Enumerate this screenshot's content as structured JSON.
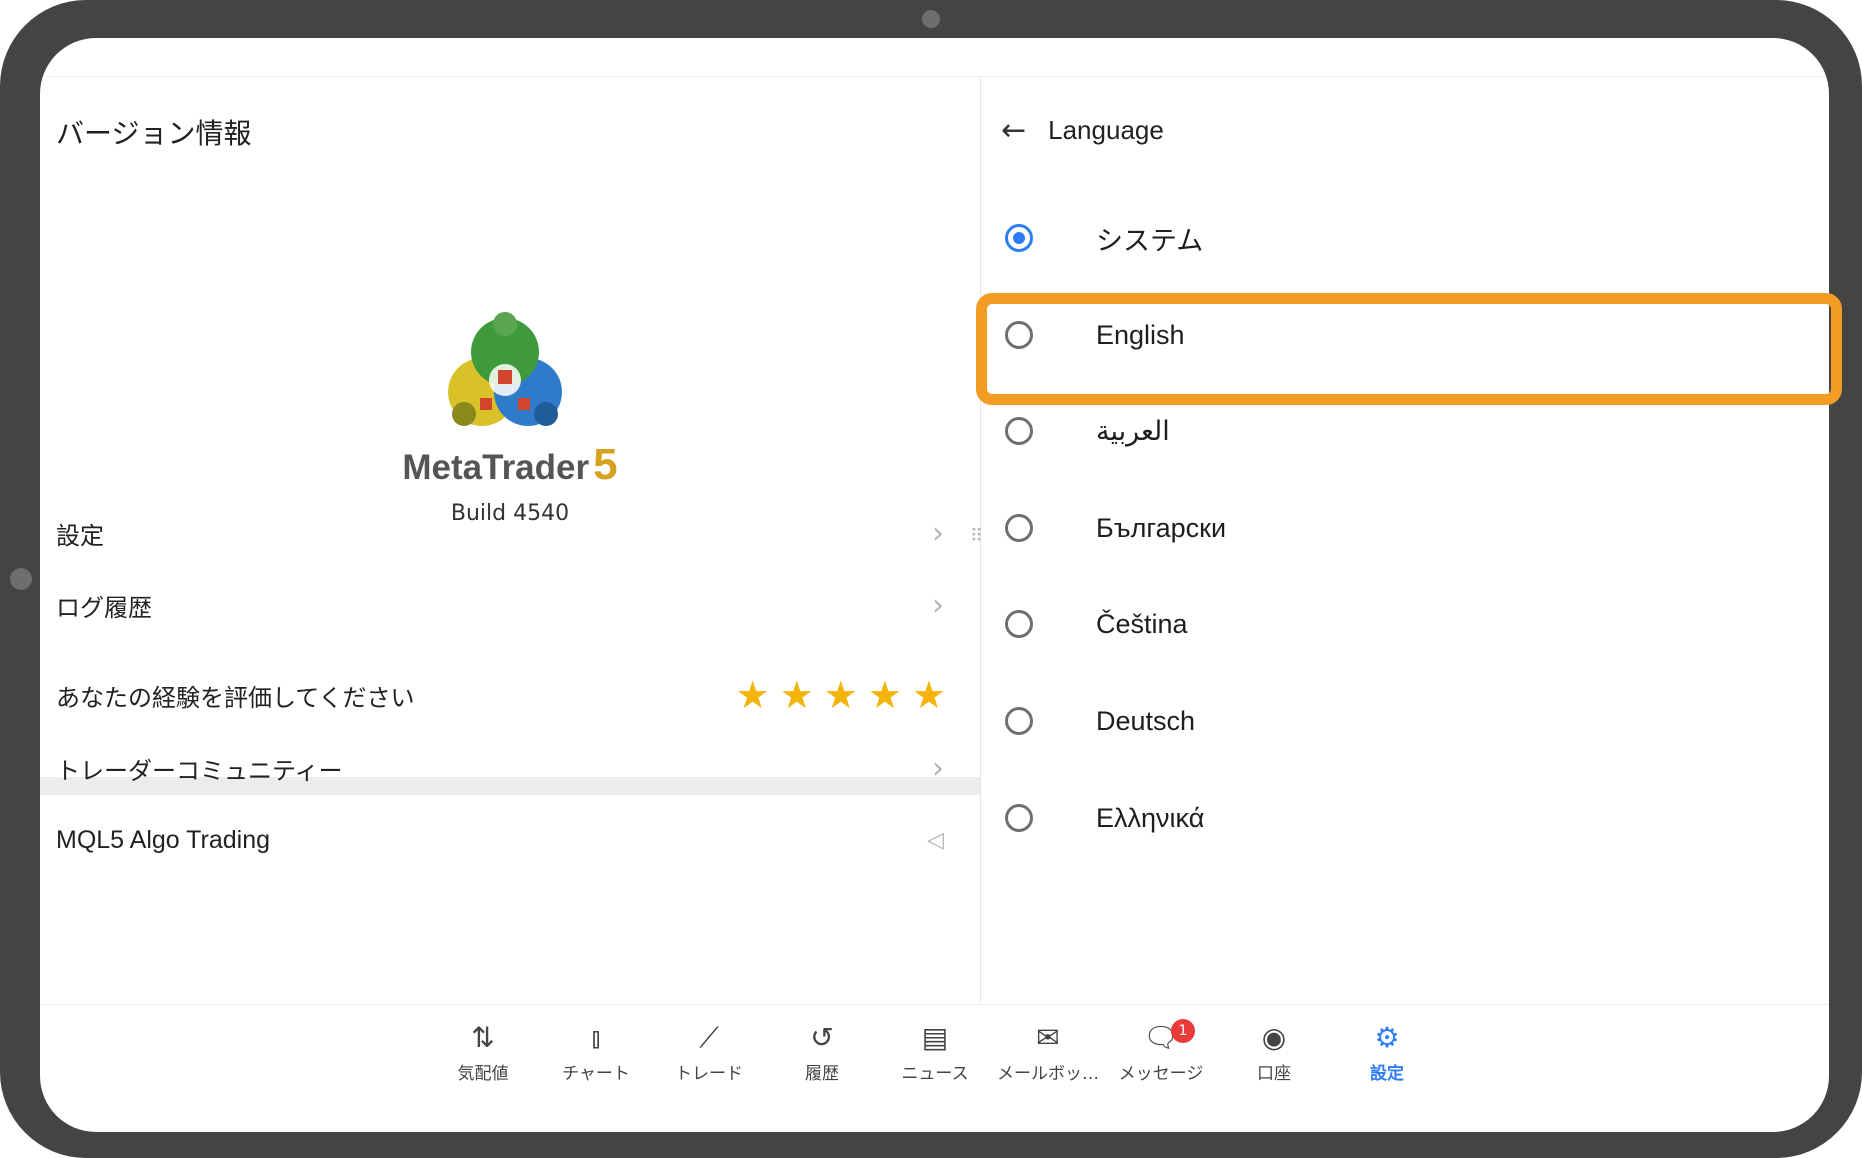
{
  "left_panel": {
    "title": "バージョン情報",
    "brand": {
      "name": "MetaTrader",
      "version_mark": "5"
    },
    "build": "Build 4540",
    "menu": [
      {
        "label": "設定"
      },
      {
        "label": "ログ履歴"
      }
    ],
    "rating": {
      "label": "あなたの経験を評価してください",
      "stars": 5
    },
    "community": {
      "label": "トレーダーコミュニティー"
    },
    "mql5": {
      "label": "MQL5 Algo Trading"
    }
  },
  "right_panel": {
    "title": "Language",
    "languages": [
      {
        "label": "システム",
        "selected": true
      },
      {
        "label": "English",
        "selected": false
      },
      {
        "label": "العربية",
        "selected": false
      },
      {
        "label": "Български",
        "selected": false
      },
      {
        "label": "Čeština",
        "selected": false
      },
      {
        "label": "Deutsch",
        "selected": false
      },
      {
        "label": "Ελληνικά",
        "selected": false
      }
    ]
  },
  "highlight": {
    "target": "English",
    "color": "#f39c24"
  },
  "bottom_nav": [
    {
      "label": "気配値",
      "icon": "quotes-icon"
    },
    {
      "label": "チャート",
      "icon": "chart-icon"
    },
    {
      "label": "トレード",
      "icon": "trade-icon"
    },
    {
      "label": "履歴",
      "icon": "history-icon"
    },
    {
      "label": "ニュース",
      "icon": "news-icon"
    },
    {
      "label": "メールボッ…",
      "icon": "mail-icon"
    },
    {
      "label": "メッセージ",
      "icon": "messages-icon",
      "badge": "1"
    },
    {
      "label": "口座",
      "icon": "account-icon"
    },
    {
      "label": "設定",
      "icon": "settings-icon",
      "active": true
    }
  ],
  "colors": {
    "accent": "#2e7cf6",
    "star": "#f5b40a",
    "badge": "#ea3b3b"
  }
}
